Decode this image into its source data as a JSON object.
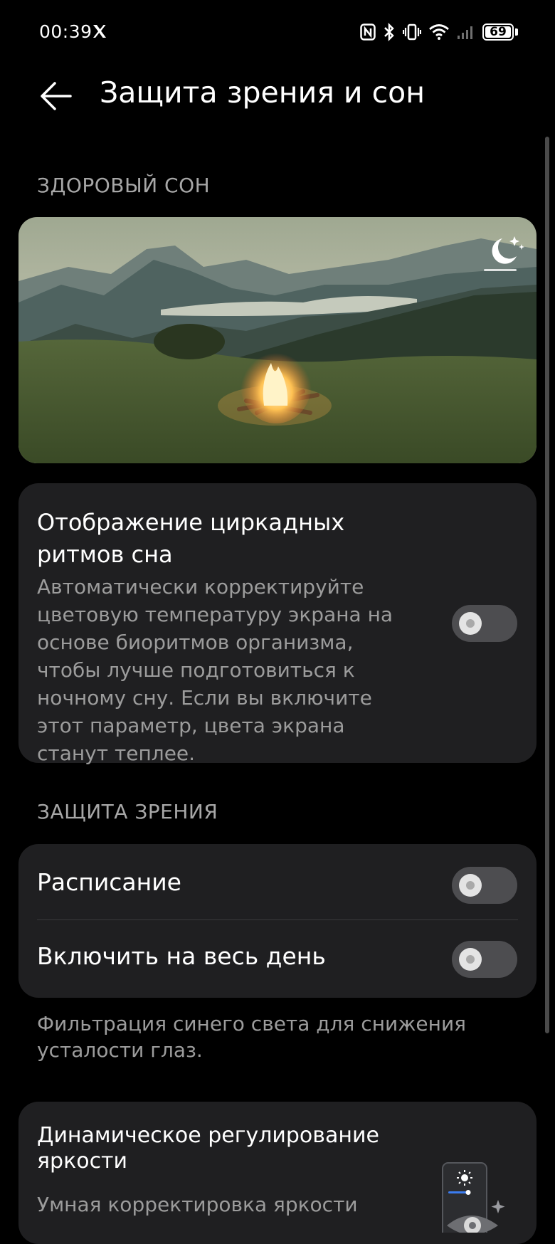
{
  "status_bar": {
    "time": "00:39",
    "battery_level": "69",
    "icons": [
      "x-logo-icon",
      "nfc-icon",
      "bluetooth-icon",
      "vibrate-icon",
      "wifi-icon",
      "signal-icon",
      "battery-icon"
    ]
  },
  "header": {
    "title": "Защита зрения и сон",
    "back_icon": "arrow-left-icon"
  },
  "sections": {
    "sleep_label": "ЗДОРОВЫЙ СОН",
    "eye_label": "ЗАЩИТА ЗРЕНИЯ"
  },
  "hero": {
    "badge_icon": "moon-stars-icon"
  },
  "circadian": {
    "title": "Отображение циркадных ритмов сна",
    "description": "Автоматически корректируйте цветовую температуру экрана на основе биоритмов организма, чтобы лучше подготовиться к ночному сну. Если вы включите этот параметр, цвета экрана станут теплее.",
    "enabled": false
  },
  "eye_protection": {
    "schedule_label": "Расписание",
    "schedule_enabled": false,
    "all_day_label": "Включить на весь день",
    "all_day_enabled": false,
    "footnote": "Фильтрация синего света для снижения усталости глаз."
  },
  "dynamic_brightness": {
    "title": "Динамическое регулирование яркости",
    "description": "Умная корректировка яркости"
  },
  "colors": {
    "background": "#000000",
    "card": "#1f1f21",
    "secondary_text": "#9c9c9c",
    "toggle_off": "#4d4d50"
  }
}
